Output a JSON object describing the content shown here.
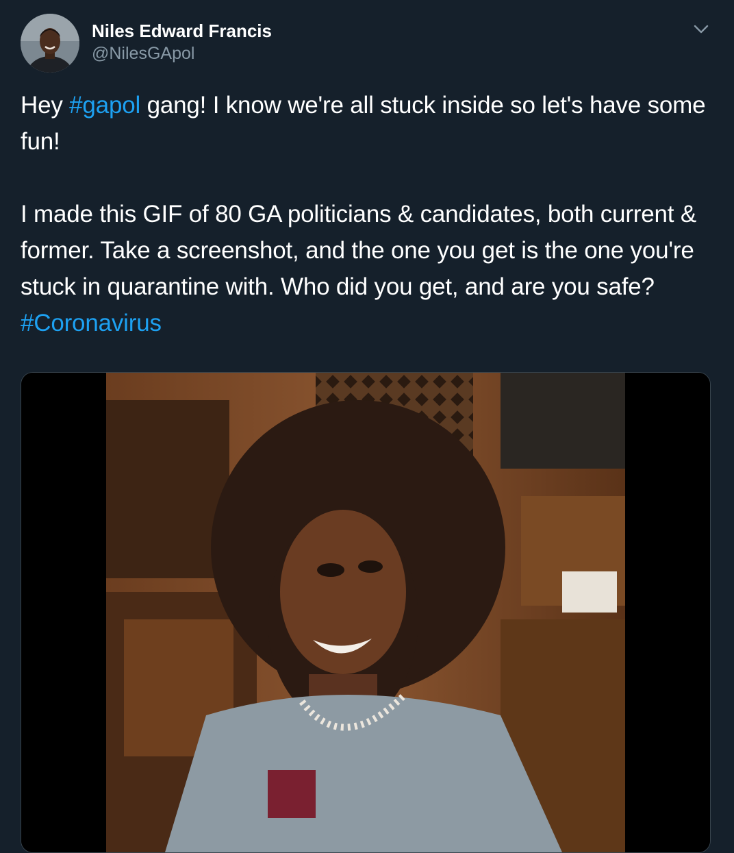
{
  "author": {
    "display_name": "Niles Edward Francis",
    "handle": "@NilesGApol"
  },
  "tweet": {
    "line1_before": "Hey ",
    "hashtag1": "#gapol",
    "line1_after": " gang! I know we're all stuck inside so let's have some fun!",
    "paragraph2_before": "I made this GIF of 80 GA politicians & candidates, both current & former. Take a screenshot, and the one you get is the one you're stuck in quarantine with. Who did you get, and are you safe? ",
    "hashtag2": "#Coronavirus"
  },
  "icons": {
    "menu": "chevron-down-icon",
    "avatar": "avatar-photo"
  },
  "colors": {
    "background": "#15202b",
    "text": "#ffffff",
    "secondary": "#8899a6",
    "link": "#1da1f2",
    "border": "#38444d"
  }
}
